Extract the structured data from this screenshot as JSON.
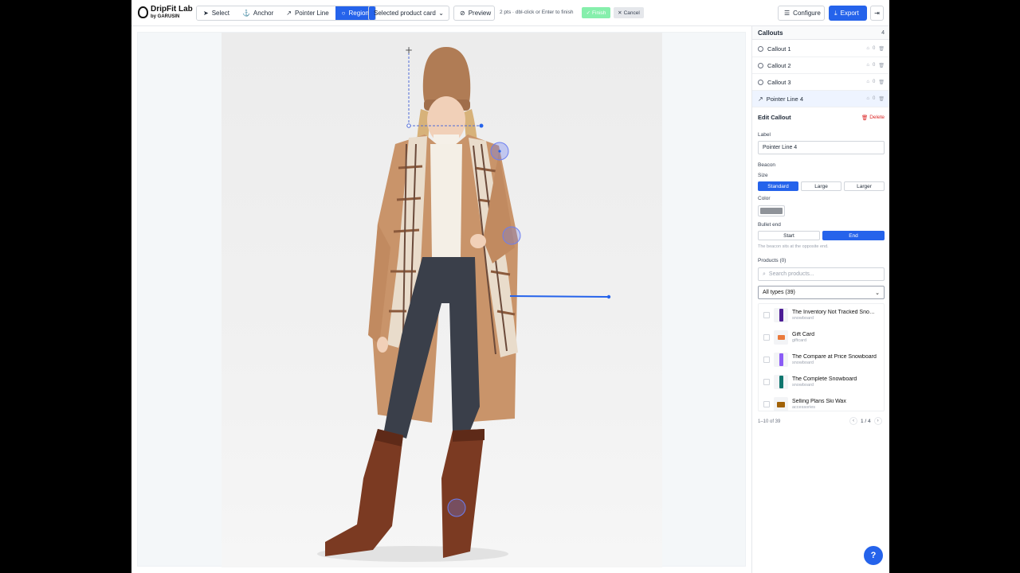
{
  "brand": {
    "name": "DripFit Lab",
    "byline": "by GARUSIN"
  },
  "toolbar": {
    "tools": [
      {
        "label": "Select",
        "icon": "cursor-icon"
      },
      {
        "label": "Anchor",
        "icon": "anchor-icon"
      },
      {
        "label": "Pointer Line",
        "icon": "pointer-line-icon"
      },
      {
        "label": "Region",
        "icon": "region-icon",
        "active": true
      }
    ],
    "card_select": "Selected product card",
    "preview": "Preview",
    "hint": "2 pts · dbl-click or Enter to finish",
    "finish": "Finish",
    "cancel": "Cancel",
    "configure": "Configure",
    "export": "Export"
  },
  "sidebar": {
    "title": "Callouts",
    "count": "4",
    "callouts": [
      {
        "label": "Callout 1",
        "tags": "0"
      },
      {
        "label": "Callout 2",
        "tags": "0"
      },
      {
        "label": "Callout 3",
        "tags": "0"
      },
      {
        "label": "Pointer Line 4",
        "tags": "0",
        "selected": true
      }
    ],
    "edit": {
      "title": "Edit Callout",
      "delete": "Delete",
      "label_label": "Label",
      "label_value": "Pointer Line 4",
      "beacon": "Beacon",
      "size": "Size",
      "sizes": [
        "Standard",
        "Large",
        "Larger"
      ],
      "size_selected": "Standard",
      "color": "Color",
      "color_value": "#8f9399",
      "bullet_end": "Bullet end",
      "ends": [
        "Start",
        "End"
      ],
      "end_selected": "End",
      "note": "The beacon sits at the opposite end."
    },
    "products": {
      "title": "Products (0)",
      "search_placeholder": "Search products...",
      "type_filter": "All types (39)",
      "items": [
        {
          "name": "The Inventory Not Tracked Snowboard",
          "type": "snowboard",
          "thumb": "#4c1d95"
        },
        {
          "name": "Gift Card",
          "type": "giftcard",
          "thumb": "#ea7a3b"
        },
        {
          "name": "The Compare at Price Snowboard",
          "type": "snowboard",
          "thumb": "#8b5cf6"
        },
        {
          "name": "The Complete Snowboard",
          "type": "snowboard",
          "thumb": "#0f766e"
        },
        {
          "name": "Selling Plans Ski Wax",
          "type": "accessories",
          "thumb": "#a16207"
        }
      ],
      "range": "1–10 of 39",
      "page": "1 / 4"
    }
  },
  "accent": "#2563eb",
  "help": "?"
}
